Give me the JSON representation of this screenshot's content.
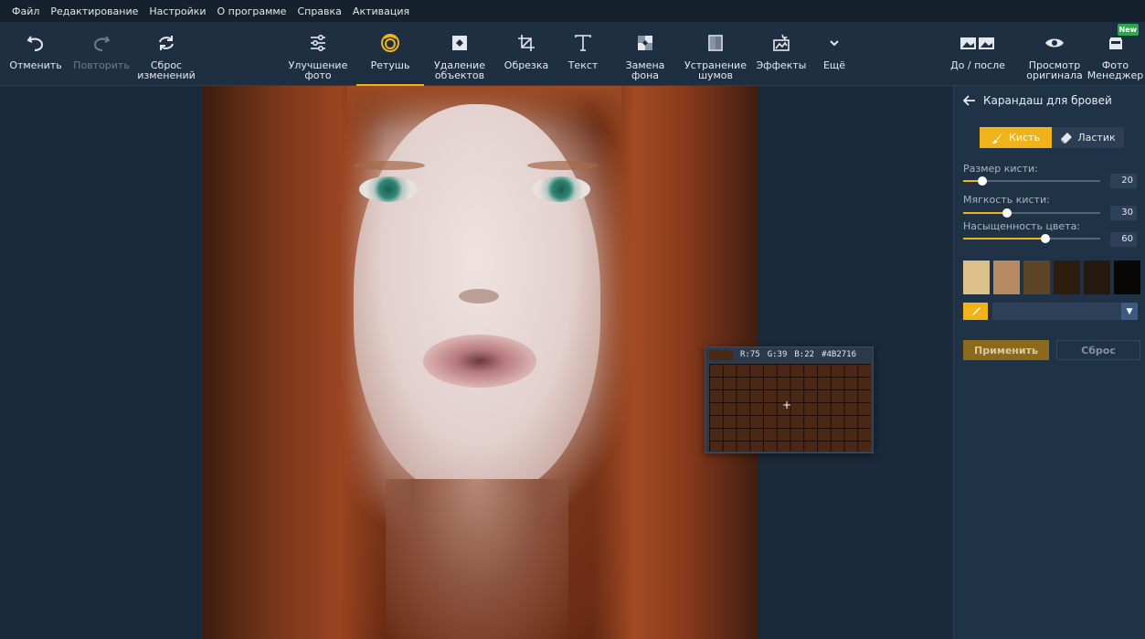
{
  "menu": [
    "Файл",
    "Редактирование",
    "Настройки",
    "О программе",
    "Справка",
    "Активация"
  ],
  "toolbar": {
    "undo": "Отменить",
    "redo": "Повторить",
    "reset": "Сброс\nизменений",
    "enhance": "Улучшение\nфото",
    "retouch": "Ретушь",
    "remove_objects": "Удаление\nобъектов",
    "crop": "Обрезка",
    "text": "Текст",
    "replace_bg": "Замена\nфона",
    "denoise": "Устранение\nшумов",
    "effects": "Эффекты",
    "more": "Ещё",
    "before_after": "До / после",
    "view_original": "Просмотр\nоригинала",
    "photo_manager": "Фото\nМенеджер",
    "new_badge": "New",
    "active_tool": "retouch"
  },
  "picker": {
    "r": "R:75",
    "g": "G:39",
    "b": "B:22",
    "hex": "#4B2716",
    "color": "#4b2716"
  },
  "panel": {
    "title": "Карандаш для бровей",
    "brush": "Кисть",
    "eraser": "Ластик",
    "brush_size_label": "Размер кисти:",
    "brush_size": "20",
    "softness_label": "Мягкость кисти:",
    "softness": "30",
    "saturation_label": "Насыщенность цвета:",
    "saturation": "60",
    "swatches": [
      "#dcc08c",
      "#b88a62",
      "#5c4526",
      "#2e1d0e",
      "#26190e",
      "#090807"
    ],
    "apply": "Применить",
    "reset": "Сброс"
  },
  "colors": {
    "accent": "#f2b21a",
    "toolbar_bg": "#1f2f42",
    "panel_bg": "#203246"
  }
}
